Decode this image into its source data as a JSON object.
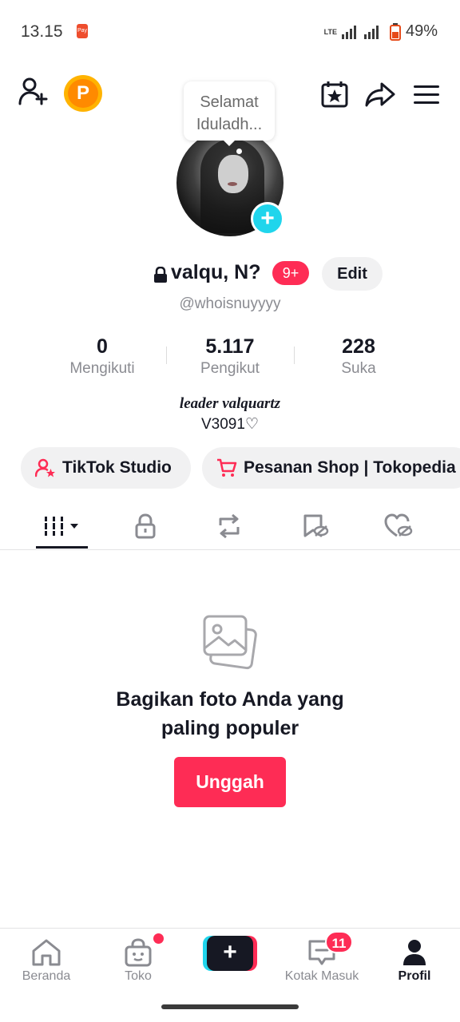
{
  "status_bar": {
    "time": "13.15",
    "pay_badge": "Pay",
    "network": "LTE",
    "battery": "49%"
  },
  "header": {
    "add_friend_icon": "person-plus-icon",
    "coin_icon": "p-coin-icon",
    "calendar_icon": "calendar-star-icon",
    "share_icon": "share-arrow-icon",
    "menu_icon": "hamburger-menu-icon"
  },
  "note_bubble": {
    "line1": "Selamat",
    "line2": "Iduladh..."
  },
  "profile": {
    "display_name": "valqu, N?",
    "notification_badge": "9+",
    "edit_label": "Edit",
    "handle": "@whoisnuyyyy",
    "add_symbol": "+"
  },
  "stats": [
    {
      "value": "0",
      "label": "Mengikuti"
    },
    {
      "value": "5.117",
      "label": "Pengikut"
    },
    {
      "value": "228",
      "label": "Suka"
    }
  ],
  "bio": {
    "line1": "leader valquartz",
    "line2": "V3091♡"
  },
  "chips": [
    {
      "label": "TikTok Studio",
      "icon": "person-star-icon"
    },
    {
      "label": "Pesanan Shop | Tokopedia",
      "icon": "cart-icon"
    }
  ],
  "tabs": [
    {
      "icon": "grid-icon",
      "active": true
    },
    {
      "icon": "lock-icon"
    },
    {
      "icon": "repost-icon"
    },
    {
      "icon": "bookmark-hidden-icon"
    },
    {
      "icon": "heart-hidden-icon"
    }
  ],
  "empty_state": {
    "icon": "photos-icon",
    "title_line1": "Bagikan foto Anda yang",
    "title_line2": "paling populer",
    "button": "Unggah"
  },
  "bottom_nav": {
    "home": "Beranda",
    "shop": "Toko",
    "create": "+",
    "inbox": "Kotak Masuk",
    "inbox_badge": "11",
    "profile": "Profil"
  },
  "colors": {
    "accent_red": "#fe2c55",
    "accent_cyan": "#20d5ec",
    "text_primary": "#161823",
    "text_secondary": "#8a8b91",
    "coin_orange": "#ff8a00"
  }
}
